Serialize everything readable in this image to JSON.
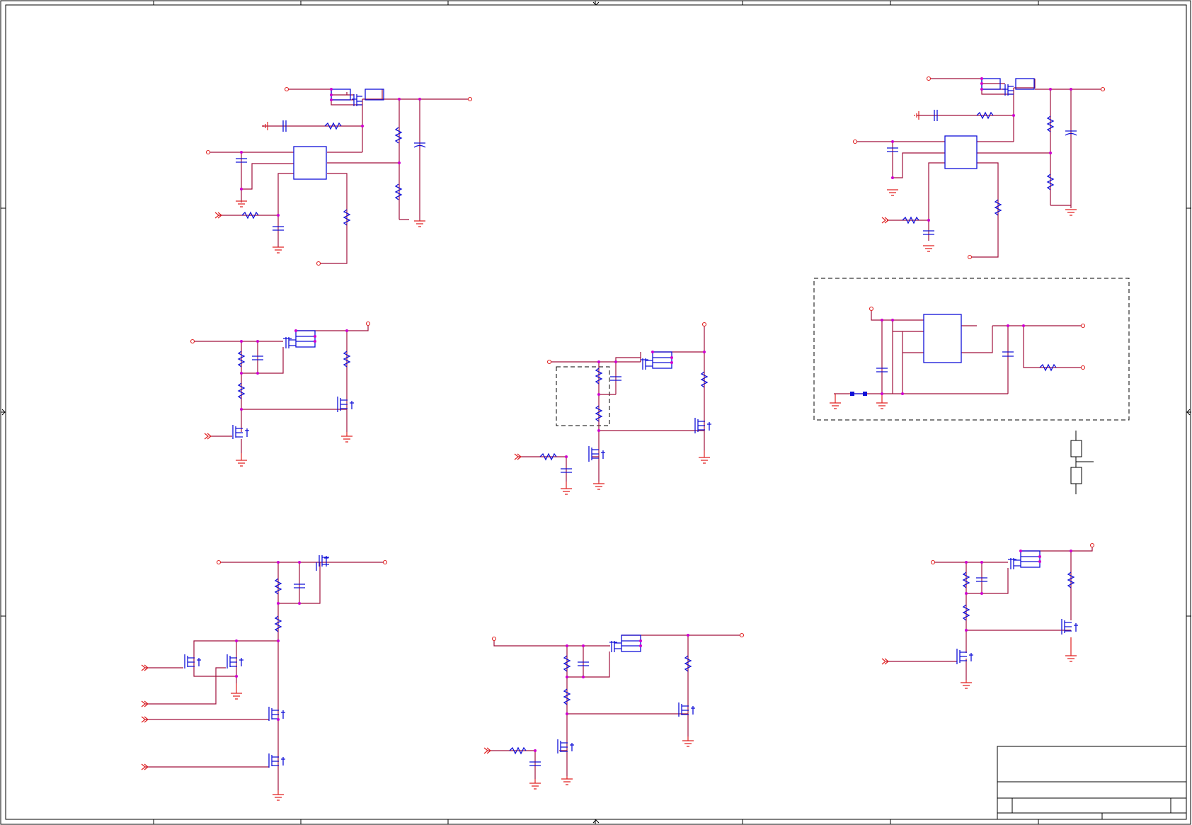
{
  "sheet": {
    "colors": {
      "wire": "#a0103c",
      "component": "#1010d8",
      "junction": "#d000d0",
      "terminal": "#e02020",
      "frame": "#000000",
      "background": "#ffffff"
    }
  }
}
